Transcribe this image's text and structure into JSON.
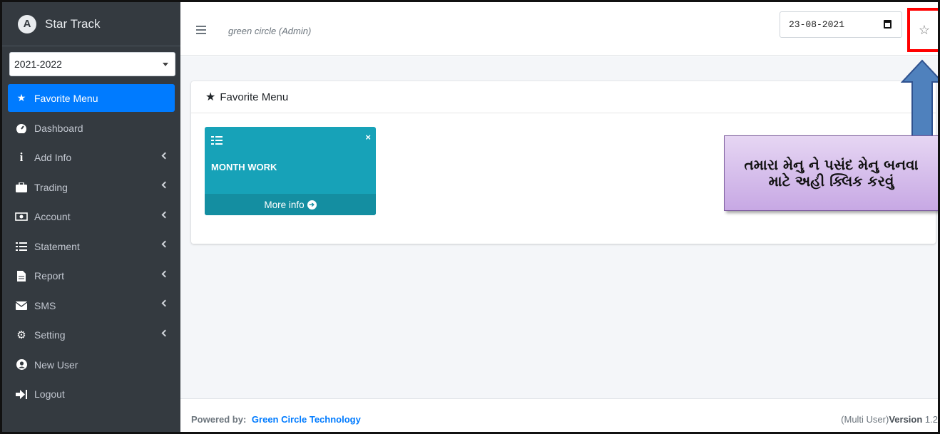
{
  "brand": {
    "name": "Star Track"
  },
  "year_select": {
    "value": "2021-2022"
  },
  "sidebar": {
    "items": [
      {
        "label": "Favorite Menu",
        "icon": "star-icon",
        "active": true,
        "has_children": false
      },
      {
        "label": "Dashboard",
        "icon": "tachometer-icon",
        "active": false,
        "has_children": false
      },
      {
        "label": "Add Info",
        "icon": "info-icon",
        "active": false,
        "has_children": true
      },
      {
        "label": "Trading",
        "icon": "briefcase-icon",
        "active": false,
        "has_children": true
      },
      {
        "label": "Account",
        "icon": "money-bill-icon",
        "active": false,
        "has_children": true
      },
      {
        "label": "Statement",
        "icon": "list-check-icon",
        "active": false,
        "has_children": true
      },
      {
        "label": "Report",
        "icon": "file-icon",
        "active": false,
        "has_children": true
      },
      {
        "label": "SMS",
        "icon": "envelope-icon",
        "active": false,
        "has_children": true
      },
      {
        "label": "Setting",
        "icon": "cogs-icon",
        "active": false,
        "has_children": true
      },
      {
        "label": "New User",
        "icon": "user-circle-icon",
        "active": false,
        "has_children": false
      },
      {
        "label": "Logout",
        "icon": "sign-out-icon",
        "active": false,
        "has_children": false
      }
    ]
  },
  "topbar": {
    "org_name": "green circle (Admin)",
    "date_value": "23-08-2021"
  },
  "card": {
    "title": "Favorite Menu"
  },
  "tile": {
    "title": "MONTH WORK",
    "footer_label": "More info",
    "close_glyph": "×"
  },
  "annotation": {
    "text": "તમારા મેનુ ને પસંદ મેનુ બનવા માટે અહી ક્લિક કરવું"
  },
  "footer": {
    "powered_label": "Powered by:",
    "company": "Green Circle Technology",
    "edition": "(Multi User)",
    "version_label": "Version",
    "version_number": "1.2"
  },
  "colors": {
    "sidebar_bg": "#343a40",
    "active_blue": "#007bff",
    "tile_teal": "#17a2b8",
    "highlight_red": "#ff0000"
  }
}
